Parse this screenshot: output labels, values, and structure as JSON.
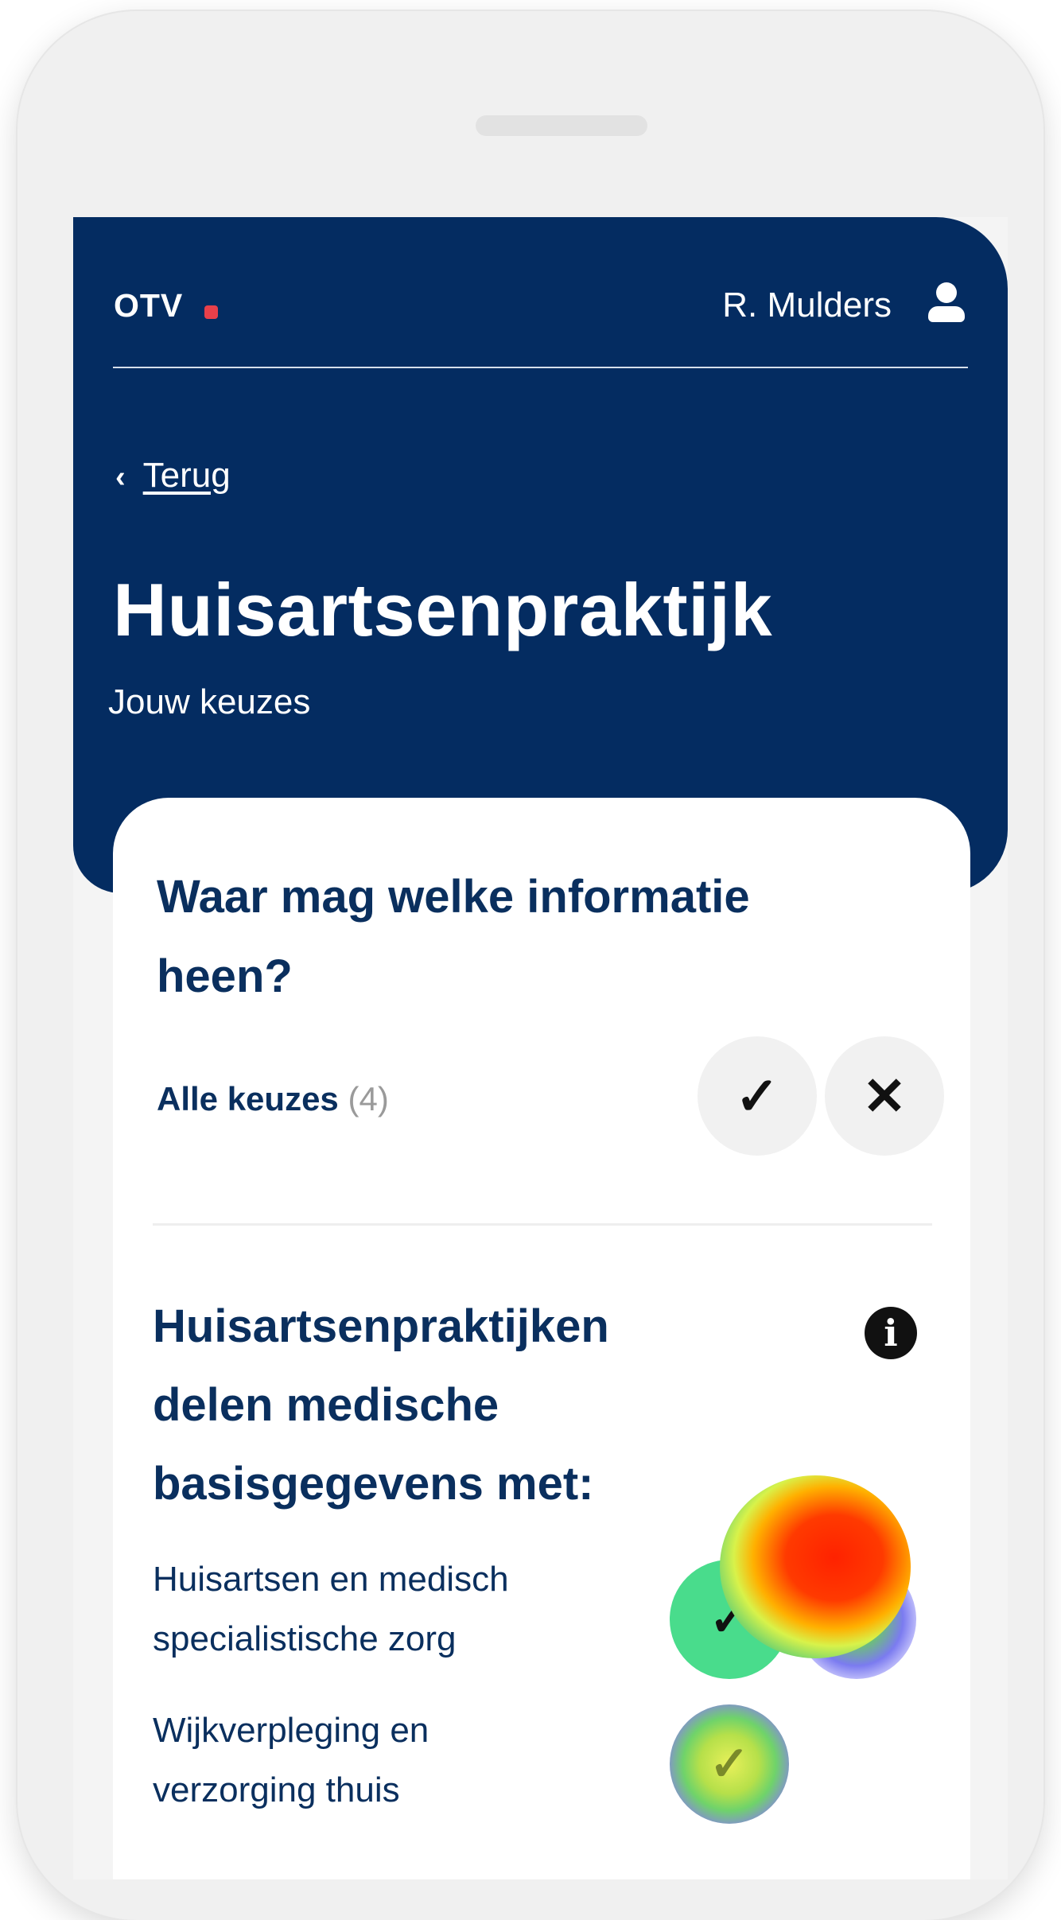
{
  "header": {
    "brand": "OTV",
    "user_name": "R. Mulders",
    "back_label": "Terug",
    "title": "Huisartsenpraktijk",
    "subtitle": "Jouw keuzes"
  },
  "card": {
    "title": "Waar mag welke informatie heen?",
    "all_choices_label": "Alle keuzes",
    "all_choices_count": "(4)",
    "section_title": "Huisartsenpraktijken delen medische basisgegevens met:",
    "rows": [
      {
        "label": "Huisartsen en medisch specialistische zorg",
        "state": "yes"
      },
      {
        "label": "Wijkverpleging en verzorging thuis",
        "state": "none"
      }
    ]
  },
  "icons": {
    "check": "✓",
    "cross": "✕",
    "info": "i",
    "back": "‹"
  },
  "colors": {
    "header_bg": "#042c61",
    "accent_dot": "#e8404a",
    "title_text": "#0a2f5e",
    "yes_active": "#49dc8c"
  }
}
